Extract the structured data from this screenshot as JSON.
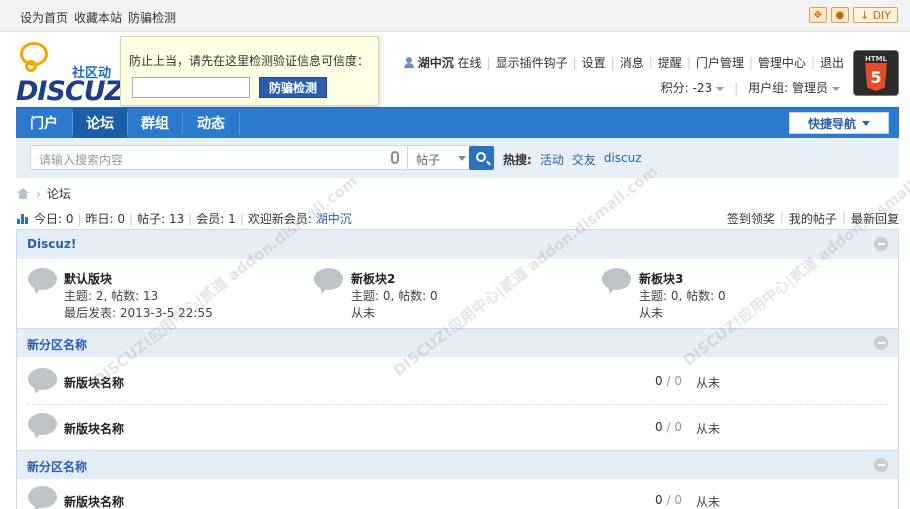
{
  "topbar": {
    "links": [
      "设为首页",
      "收藏本站",
      "防骗检测"
    ],
    "diy_label": "DIY"
  },
  "logo": {
    "cn": "社区动",
    "en": "DISCUZ"
  },
  "popup": {
    "message": "防止上当，请先在这里检测验证信息可信度：",
    "input_value": "",
    "button_label": "防骗检测"
  },
  "user": {
    "name": "湖中沉",
    "status": "在线",
    "links": [
      "显示插件钩子",
      "设置",
      "消息",
      "提醒",
      "门户管理",
      "管理中心",
      "退出"
    ],
    "points_label": "积分: -23",
    "group_label": "用户组: 管理员"
  },
  "avatar": {
    "badge_text": "5",
    "caption": "HTML"
  },
  "nav": {
    "items": [
      "门户",
      "论坛",
      "群组",
      "动态"
    ],
    "active": "论坛",
    "quick_nav": "快捷导航"
  },
  "search": {
    "placeholder": "请输入搜索内容",
    "type": "帖子",
    "hot_label": "热搜:",
    "hot_keywords": [
      "活动",
      "交友",
      "discuz"
    ]
  },
  "breadcrumb": {
    "current": "论坛"
  },
  "stats": {
    "today": "今日: 0",
    "yesterday": "昨日: 0",
    "posts": "帖子: 13",
    "members": "会员: 1",
    "welcome": "欢迎新会员:",
    "new_member": "湖中沉"
  },
  "right_links": [
    "签到领奖",
    "我的帖子",
    "最新回复"
  ],
  "categories": [
    {
      "title": "Discuz!",
      "forums": [
        {
          "name": "默认版块",
          "stats": "主题: 2, 帖数: 13",
          "last": "最后发表: 2013-3-5 22:55"
        },
        {
          "name": "新板块2",
          "stats": "主题: 0, 帖数: 0",
          "last": "从未"
        },
        {
          "name": "新板块3",
          "stats": "主题: 0, 帖数: 0",
          "last": "从未"
        }
      ]
    },
    {
      "title": "新分区名称",
      "forums": [
        {
          "name": "新版块名称",
          "threads": "0",
          "posts": "0",
          "last": "从未"
        },
        {
          "name": "新版块名称",
          "threads": "0",
          "posts": "0",
          "last": "从未"
        }
      ]
    },
    {
      "title": "新分区名称",
      "forums": [
        {
          "name": "新版块名称",
          "threads": "0",
          "posts": "0",
          "last": "从未"
        }
      ]
    }
  ],
  "watermark": "DISCUZ!应用中心|贰道 addon.dismall.com",
  "colors": {
    "nav_blue": "#2b7acd",
    "nav_active": "#195ea6",
    "link_blue": "#2b5fae",
    "category_bg": "#e5eef6"
  }
}
